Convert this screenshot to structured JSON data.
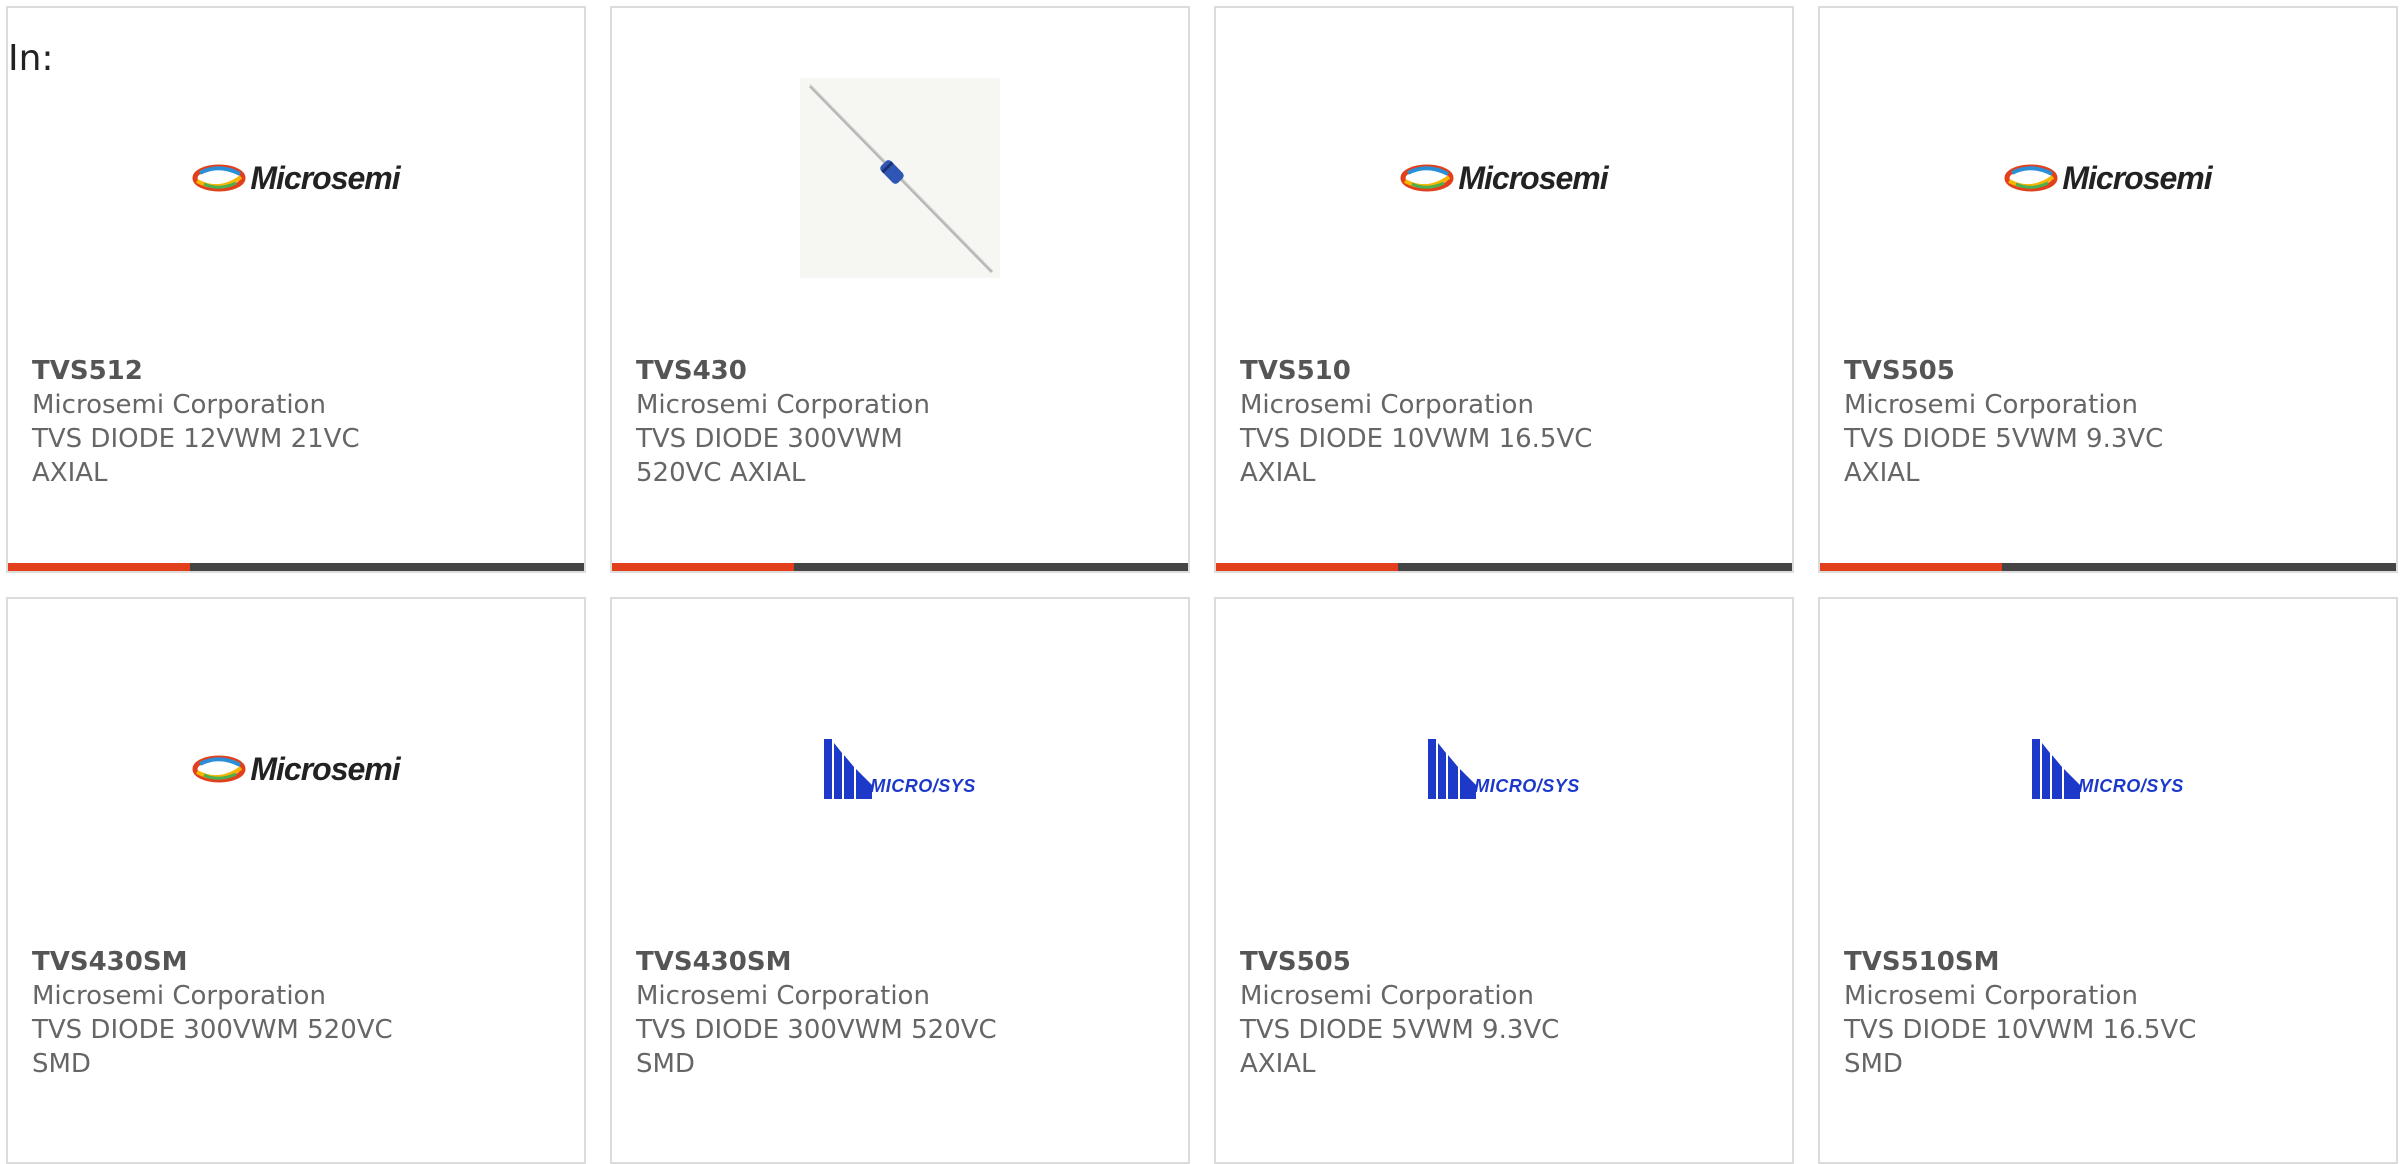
{
  "page": {
    "in_label": "In:"
  },
  "colors": {
    "accent": "#e2401c",
    "bar": "#444444",
    "microsys_blue": "#1c39c9"
  },
  "products": [
    {
      "part": "TVS512",
      "maker": "Microsemi Corporation",
      "desc": "TVS DIODE 12VWM 21VC AXIAL",
      "image": "microsemi-logo",
      "logo_text": "Microsemi",
      "bar": true
    },
    {
      "part": "TVS430",
      "maker": "Microsemi Corporation",
      "desc": "TVS DIODE 300VWM 520VC AXIAL",
      "image": "axial-diode-photo",
      "logo_text": "",
      "bar": true
    },
    {
      "part": "TVS510",
      "maker": "Microsemi Corporation",
      "desc": "TVS DIODE 10VWM 16.5VC AXIAL",
      "image": "microsemi-logo",
      "logo_text": "Microsemi",
      "bar": true
    },
    {
      "part": "TVS505",
      "maker": "Microsemi Corporation",
      "desc": "TVS DIODE 5VWM 9.3VC AXIAL",
      "image": "microsemi-logo",
      "logo_text": "Microsemi",
      "bar": true
    },
    {
      "part": "TVS430SM",
      "maker": "Microsemi Corporation",
      "desc": "TVS DIODE 300VWM 520VC SMD",
      "image": "microsemi-logo",
      "logo_text": "Microsemi",
      "bar": false
    },
    {
      "part": "TVS430SM",
      "maker": "Microsemi Corporation",
      "desc": "TVS DIODE 300VWM 520VC SMD",
      "image": "microsys-logo",
      "logo_text": "MICRO/SYS",
      "bar": false
    },
    {
      "part": "TVS505",
      "maker": "Microsemi Corporation",
      "desc": "TVS DIODE 5VWM 9.3VC AXIAL",
      "image": "microsys-logo",
      "logo_text": "MICRO/SYS",
      "bar": false
    },
    {
      "part": "TVS510SM",
      "maker": "Microsemi Corporation",
      "desc": "TVS DIODE 10VWM 16.5VC SMD",
      "image": "microsys-logo",
      "logo_text": "MICRO/SYS",
      "bar": false
    }
  ]
}
